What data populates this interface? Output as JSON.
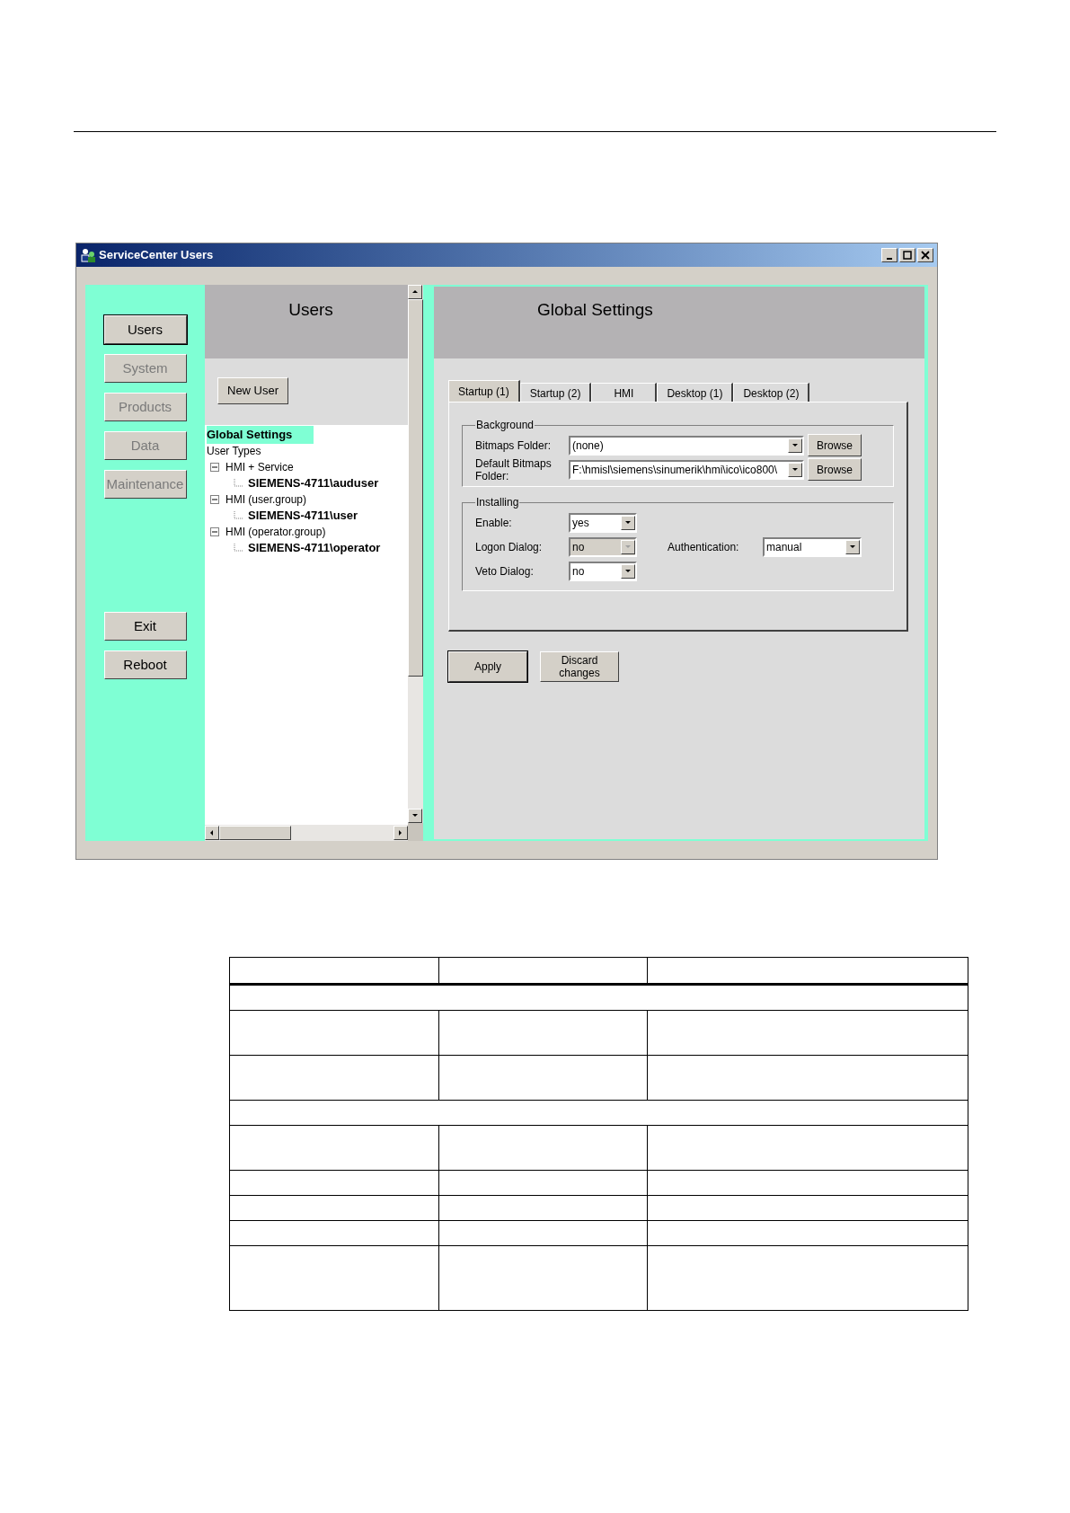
{
  "window": {
    "title": "ServiceCenter Users"
  },
  "nav": [
    {
      "label": "Users",
      "selected": true,
      "disabled": false
    },
    {
      "label": "System",
      "selected": false,
      "disabled": true
    },
    {
      "label": "Products",
      "selected": false,
      "disabled": true
    },
    {
      "label": "Data",
      "selected": false,
      "disabled": true
    },
    {
      "label": "Maintenance",
      "selected": false,
      "disabled": true
    }
  ],
  "nav_bottom": [
    {
      "label": "Exit"
    },
    {
      "label": "Reboot"
    }
  ],
  "users_pane": {
    "title": "Users",
    "new_button": "New User",
    "tree": [
      {
        "label": "Global Settings",
        "selected": true
      },
      {
        "label": "User Types",
        "selected": false,
        "children": [
          {
            "label": "HMI + Service",
            "expanded": true,
            "selected": false,
            "children": [
              {
                "label": "SIEMENS-4711\\auduser",
                "selected": false
              }
            ]
          },
          {
            "label": "HMI (user.group)",
            "expanded": true,
            "selected": false,
            "children": [
              {
                "label": "SIEMENS-4711\\user",
                "selected": false
              }
            ]
          },
          {
            "label": "HMI (operator.group)",
            "expanded": true,
            "selected": false,
            "children": [
              {
                "label": "SIEMENS-4711\\operator",
                "selected": false
              }
            ]
          }
        ]
      }
    ]
  },
  "settings_pane": {
    "title": "Global Settings",
    "tabs": [
      {
        "label": "Startup (1)",
        "selected": true
      },
      {
        "label": "Startup (2)",
        "selected": false
      },
      {
        "label": "HMI",
        "selected": false
      },
      {
        "label": "Desktop (1)",
        "selected": false
      },
      {
        "label": "Desktop (2)",
        "selected": false
      }
    ],
    "background": {
      "title": "Background",
      "fields": [
        {
          "label": "Bitmaps Folder:",
          "value": "(none)",
          "button": "Browse"
        },
        {
          "label": "Default Bitmaps Folder:",
          "value": "F:\\hmisl\\siemens\\sinumerik\\hmi\\ico\\ico800\\",
          "button": "Browse"
        }
      ]
    },
    "installing": {
      "title": "Installing",
      "rows": [
        {
          "fields": [
            {
              "label": "Enable:",
              "value": "yes",
              "disabled": false
            }
          ]
        },
        {
          "fields": [
            {
              "label": "Logon Dialog:",
              "value": "no",
              "disabled": true
            },
            {
              "label": "Authentication:",
              "value": "manual",
              "disabled": false
            }
          ]
        },
        {
          "fields": [
            {
              "label": "Veto Dialog:",
              "value": "no",
              "disabled": false
            }
          ]
        }
      ]
    },
    "buttons": [
      {
        "label": "Apply",
        "default": true
      },
      {
        "label": "Discard changes",
        "default": false
      }
    ]
  },
  "empty_table": {
    "rows": [
      {
        "kind": "header"
      },
      {
        "kind": "group"
      },
      {
        "kind": "tall"
      },
      {
        "kind": "tall"
      },
      {
        "kind": "group"
      },
      {
        "kind": "tall"
      },
      {
        "kind": "short"
      },
      {
        "kind": "short"
      },
      {
        "kind": "short"
      },
      {
        "kind": "taller"
      }
    ]
  }
}
